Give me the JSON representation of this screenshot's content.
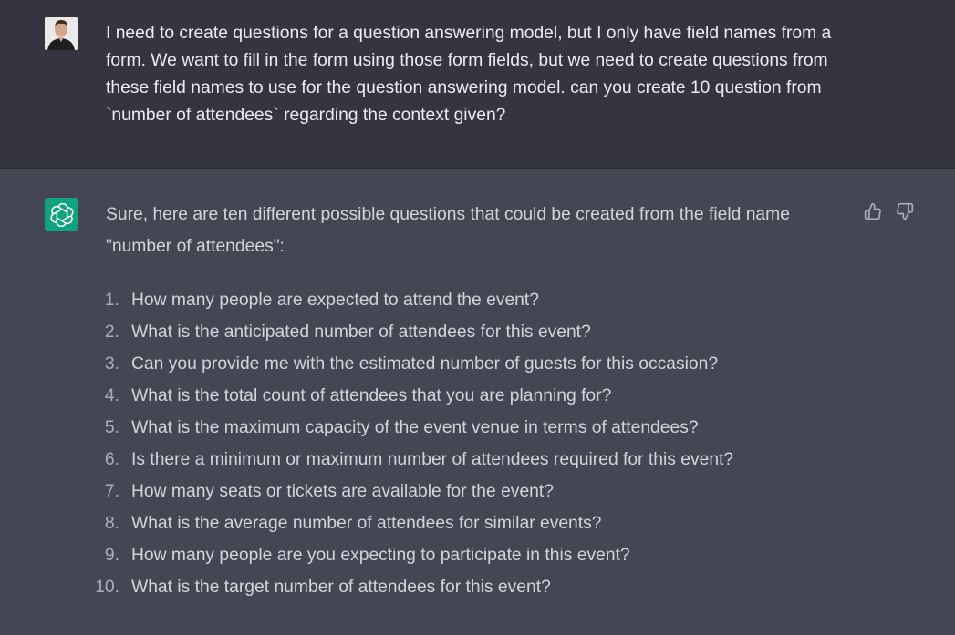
{
  "user_message": {
    "text": "I need to create questions for a question answering model, but I only have field names from a form. We want to fill in the form using those form fields, but we need to create questions from these field names to use for the question answering model. can you create 10 question from `number of attendees` regarding the context given?"
  },
  "assistant_message": {
    "intro": "Sure, here are ten different possible questions that could be created from the field name \"number of attendees\":",
    "items": [
      {
        "num": "1.",
        "text": "How many people are expected to attend the event?"
      },
      {
        "num": "2.",
        "text": "What is the anticipated number of attendees for this event?"
      },
      {
        "num": "3.",
        "text": "Can you provide me with the estimated number of guests for this occasion?"
      },
      {
        "num": "4.",
        "text": "What is the total count of attendees that you are planning for?"
      },
      {
        "num": "5.",
        "text": "What is the maximum capacity of the event venue in terms of attendees?"
      },
      {
        "num": "6.",
        "text": "Is there a minimum or maximum number of attendees required for this event?"
      },
      {
        "num": "7.",
        "text": "How many seats or tickets are available for the event?"
      },
      {
        "num": "8.",
        "text": "What is the average number of attendees for similar events?"
      },
      {
        "num": "9.",
        "text": "How many people are you expecting to participate in this event?"
      },
      {
        "num": "10.",
        "text": "What is the target number of attendees for this event?"
      }
    ]
  },
  "icons": {
    "user_avatar": "user-avatar-icon",
    "assistant_avatar": "openai-logo-icon",
    "like": "thumbs-up-icon",
    "dislike": "thumbs-down-icon"
  },
  "colors": {
    "user_bg": "#343541",
    "assistant_bg": "#444654",
    "brand": "#10a37f",
    "text": "#d1d5db"
  }
}
